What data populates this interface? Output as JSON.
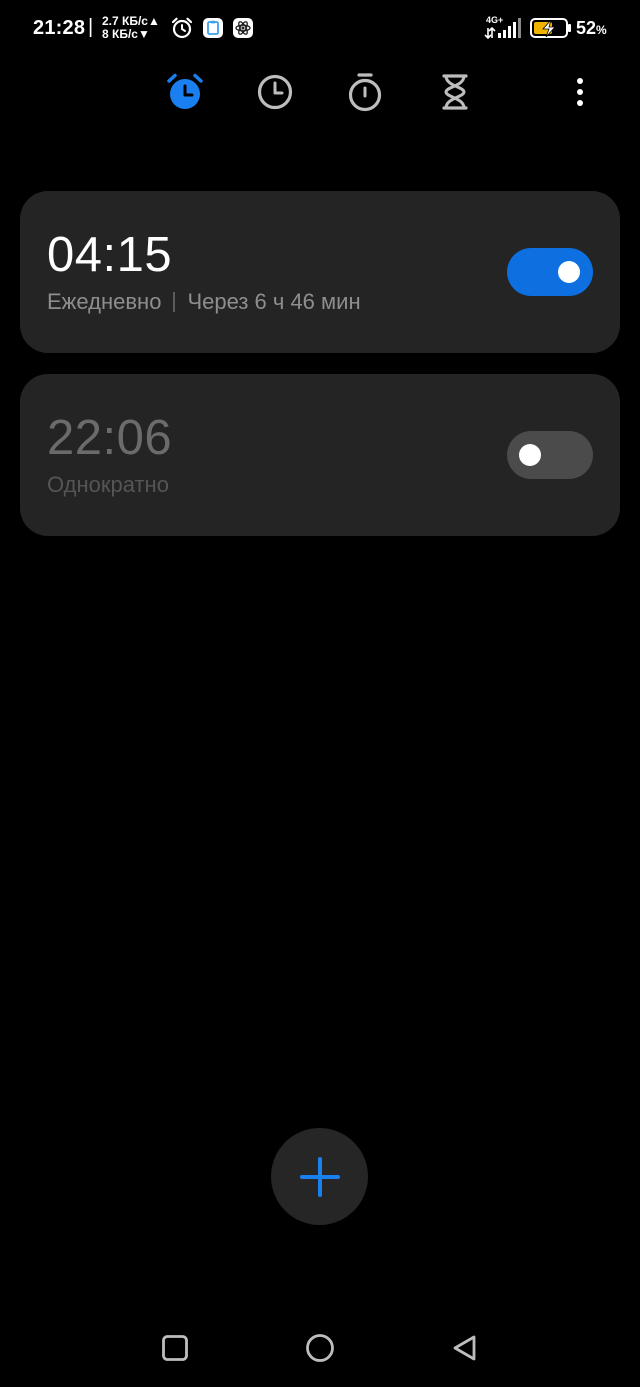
{
  "status_bar": {
    "time": "21:28",
    "separator": "|",
    "upload_speed": "2.7 КБ/с▲",
    "download_speed": "8 КБ/с▼",
    "network_label": "4G+",
    "battery_value": "52",
    "battery_unit": "%",
    "icons": [
      "alarm-clock-icon",
      "clipboard-app-icon",
      "atom-app-icon",
      "signal-icon",
      "battery-charging-icon"
    ]
  },
  "tabs": [
    {
      "name": "alarm",
      "icon": "alarm-clock-icon",
      "active": true
    },
    {
      "name": "world-clock",
      "icon": "clock-icon",
      "active": false
    },
    {
      "name": "stopwatch",
      "icon": "stopwatch-icon",
      "active": false
    },
    {
      "name": "timer",
      "icon": "hourglass-icon",
      "active": false
    }
  ],
  "alarms": [
    {
      "time": "04:15",
      "repeat": "Ежедневно",
      "remaining": "Через 6 ч 46 мин",
      "enabled": true
    },
    {
      "time": "22:06",
      "repeat": "Однократно",
      "remaining": "",
      "enabled": false
    }
  ],
  "colors": {
    "background": "#000000",
    "card": "#242424",
    "accent": "#1a7ff0",
    "toggle_on": "#0d6fe0",
    "toggle_off": "#4b4b4b",
    "fab": "#262626"
  },
  "fab": {
    "icon": "plus-icon"
  },
  "nav_bar": {
    "icons": [
      "recents-square-icon",
      "home-circle-icon",
      "back-triangle-icon"
    ]
  }
}
